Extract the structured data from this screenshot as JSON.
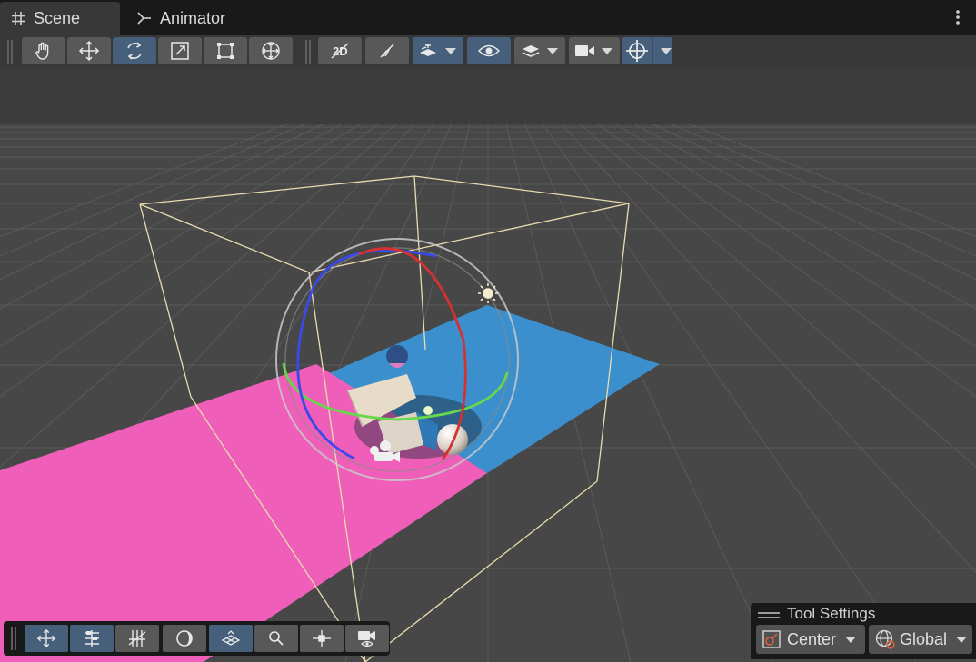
{
  "tabs": [
    {
      "label": "Scene",
      "icon": "grid-icon",
      "active": true
    },
    {
      "label": "Animator",
      "icon": "animator-icon",
      "active": false
    }
  ],
  "scene_toolbar": {
    "transform_tools": [
      "hand-tool",
      "move-tool",
      "rotate-tool",
      "scale-tool",
      "rect-tool",
      "transform-tool"
    ],
    "active_tool": "rotate-tool",
    "view_tools": [
      "2d-toggle",
      "lighting-toggle",
      "scene-fx-dropdown",
      "visibility-toggle",
      "layers-dropdown",
      "camera-dropdown",
      "gizmos-dropdown"
    ]
  },
  "overlay_toolbar": {
    "buttons": [
      "move-overlay",
      "align-overlay",
      "grid-snap-overlay",
      "shading-overlay",
      "grid-overlay",
      "search-overlay",
      "orientation-overlay",
      "camera-overlay"
    ]
  },
  "tool_settings": {
    "title": "Tool Settings",
    "pivot": "Center",
    "space": "Global"
  },
  "colors": {
    "accent": "#46607c",
    "pink_plane": "#ef5fb9",
    "blue_plane": "#3b8fcc"
  }
}
